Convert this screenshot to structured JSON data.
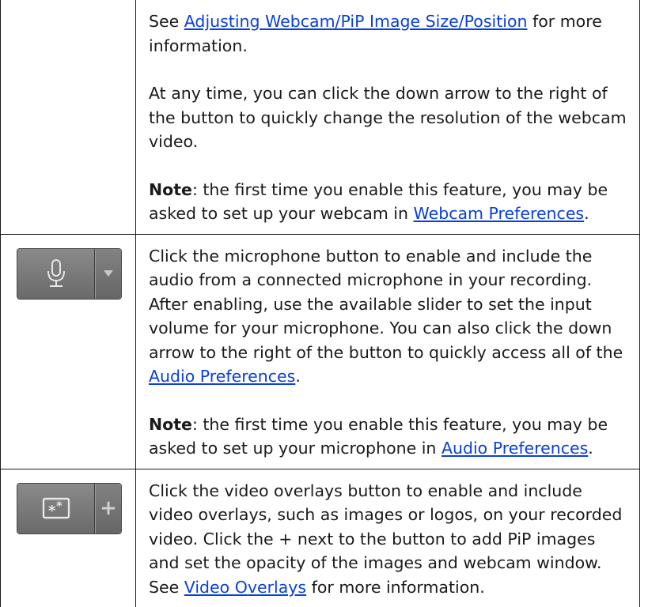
{
  "rows": [
    {
      "paragraphs": [
        {
          "pre": "See ",
          "link": "Adjusting Webcam/PiP Image Size/Position",
          "post": " for more information."
        },
        {
          "text": "At any time, you can click the down arrow to the right of the button to quickly change the resolution of the webcam video."
        },
        {
          "bold": "Note",
          "pre": ": the first time you enable this feature, you may be asked to set up your webcam in ",
          "link": "Webcam Preferences",
          "post": "."
        }
      ]
    },
    {
      "button": {
        "icon": "microphone-icon",
        "side_icon": "dropdown-arrow-icon"
      },
      "paragraphs": [
        {
          "pre": "Click the microphone button to enable and include the audio from a connected microphone in your recording. After enabling, use the available slider to set the input volume for your microphone. You can also click the down arrow to the right of the button to quickly access all of the ",
          "link": "Audio Preferences",
          "post": "."
        },
        {
          "bold": "Note",
          "pre": ": the first time you enable this feature, you may be asked to set up your microphone in ",
          "link": "Audio Preferences",
          "post": "."
        }
      ]
    },
    {
      "button": {
        "icon": "video-overlays-icon",
        "side_label": "+"
      },
      "paragraphs": [
        {
          "pre": "Click the video overlays button to enable and include video overlays, such as images or logos, on your recorded video. Click the + next to the button to add PiP images and set the opacity of the images and webcam window. See ",
          "link": "Video Overlays",
          "post": " for more information."
        }
      ]
    }
  ],
  "colors": {
    "link": "#0a40d6",
    "button_bg": "#777777",
    "border": "#1a1a1a"
  }
}
